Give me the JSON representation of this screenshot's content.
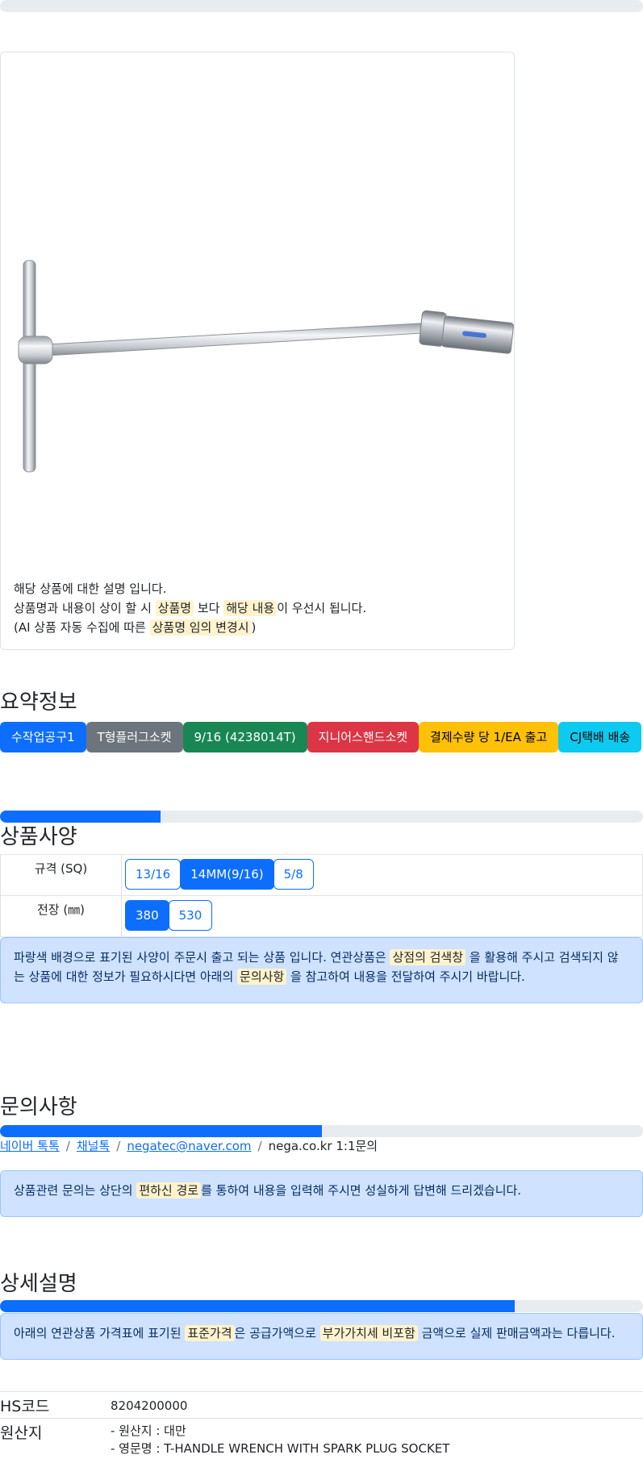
{
  "top_progress": {
    "fill_fraction": 0
  },
  "product_note": {
    "line1": "해당 상품에 대한 설명 입니다.",
    "line2_a": "상품명과 내용이 상이 할 시",
    "line2_mark1": "상품명",
    "line2_b": "보다",
    "line2_mark2": "해당 내용",
    "line2_c": "이 우선시 됩니다.",
    "line3_a": "(AI 상품 자동 수집에 따른",
    "line3_mark": "상품명 임의 변경시",
    "line3_b": ")"
  },
  "summary": {
    "title": "요약정보",
    "badges": [
      {
        "label": "수작업공구1",
        "color": "#0d6efd",
        "text_color": "#ffffff"
      },
      {
        "label": "T형플러그소켓",
        "color": "#6c757d",
        "text_color": "#ffffff"
      },
      {
        "label": "9/16 (4238014T)",
        "color": "#198754",
        "text_color": "#ffffff"
      },
      {
        "label": "지니어스핸드소켓",
        "color": "#dc3545",
        "text_color": "#ffffff"
      },
      {
        "label": "결제수량 당 1/EA 출고",
        "color": "#ffc107",
        "text_color": "#000000"
      },
      {
        "label": "CJ택배 배송",
        "color": "#0dcaf0",
        "text_color": "#000000"
      }
    ]
  },
  "specs": {
    "progress_fraction": 0.25,
    "title": "상품사양",
    "rows": [
      {
        "label": "규격 (SQ)",
        "options": [
          {
            "label": "13/16",
            "selected": false
          },
          {
            "label": "14MM(9/16)",
            "selected": true
          },
          {
            "label": "5/8",
            "selected": false
          }
        ]
      },
      {
        "label": "전장 (㎜)",
        "options": [
          {
            "label": "380",
            "selected": true
          },
          {
            "label": "530",
            "selected": false
          }
        ]
      }
    ],
    "notice_a": "파랑색 배경으로 표기된 사양이 주문시 출고 되는 상품 입니다. 연관상품은",
    "notice_mark1": "상점의 검색창",
    "notice_b": "을 활용해 주시고 검색되지 않는 상품에 대한 정보가 필요하시다면 아래의",
    "notice_mark2": "문의사항",
    "notice_c": "을 참고하여 내용을 전달하여 주시기 바랍니다."
  },
  "inquiry": {
    "title": "문의사항",
    "progress_fraction": 0.5,
    "links": {
      "naver": "네이버 톡톡",
      "channel": "채널톡",
      "email": "negatec@naver.com",
      "site": "nega.co.kr 1:1문의",
      "separator": "/"
    },
    "notice_a": "상품관련 문의는 상단의",
    "notice_mark": "편하신 경로",
    "notice_b": "를 통하여 내용을 입력해 주시면 성실하게 답변해 드리겠습니다."
  },
  "detail": {
    "title": "상세설명",
    "progress_fraction": 0.8,
    "notice_a": "아래의 연관상품 가격표에 표기된",
    "notice_mark1": "표준가격",
    "notice_b": "은 공급가액으로",
    "notice_mark2": "부가가치세 비포함",
    "notice_c": "금액으로 실제 판매금액과는 다릅니다.",
    "hs_label": "HS코드",
    "hs_value": "8204200000",
    "origin_label": "원산지",
    "origin_line1": "- 원산지 : 대만",
    "origin_line2": "- 영문명 : T-HANDLE WRENCH WITH SPARK PLUG SOCKET"
  }
}
